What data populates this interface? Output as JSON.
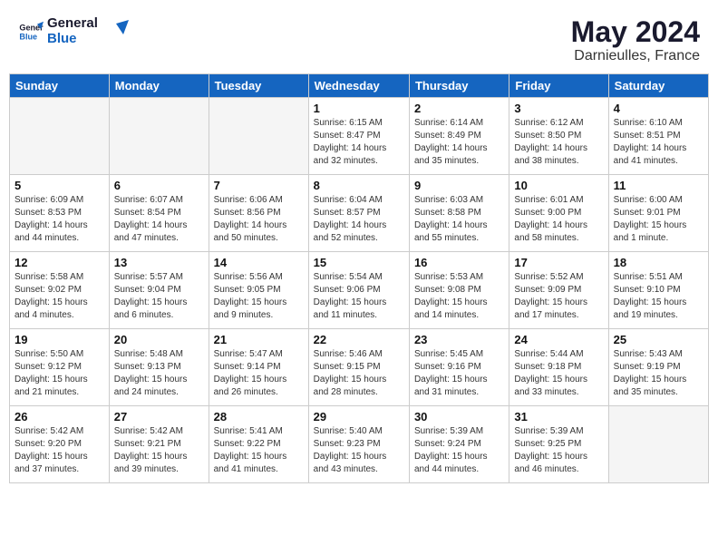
{
  "header": {
    "logo_line1": "General",
    "logo_line2": "Blue",
    "month_year": "May 2024",
    "location": "Darnieulles, France"
  },
  "weekdays": [
    "Sunday",
    "Monday",
    "Tuesday",
    "Wednesday",
    "Thursday",
    "Friday",
    "Saturday"
  ],
  "weeks": [
    [
      {
        "day": "",
        "text": ""
      },
      {
        "day": "",
        "text": ""
      },
      {
        "day": "",
        "text": ""
      },
      {
        "day": "1",
        "text": "Sunrise: 6:15 AM\nSunset: 8:47 PM\nDaylight: 14 hours\nand 32 minutes."
      },
      {
        "day": "2",
        "text": "Sunrise: 6:14 AM\nSunset: 8:49 PM\nDaylight: 14 hours\nand 35 minutes."
      },
      {
        "day": "3",
        "text": "Sunrise: 6:12 AM\nSunset: 8:50 PM\nDaylight: 14 hours\nand 38 minutes."
      },
      {
        "day": "4",
        "text": "Sunrise: 6:10 AM\nSunset: 8:51 PM\nDaylight: 14 hours\nand 41 minutes."
      }
    ],
    [
      {
        "day": "5",
        "text": "Sunrise: 6:09 AM\nSunset: 8:53 PM\nDaylight: 14 hours\nand 44 minutes."
      },
      {
        "day": "6",
        "text": "Sunrise: 6:07 AM\nSunset: 8:54 PM\nDaylight: 14 hours\nand 47 minutes."
      },
      {
        "day": "7",
        "text": "Sunrise: 6:06 AM\nSunset: 8:56 PM\nDaylight: 14 hours\nand 50 minutes."
      },
      {
        "day": "8",
        "text": "Sunrise: 6:04 AM\nSunset: 8:57 PM\nDaylight: 14 hours\nand 52 minutes."
      },
      {
        "day": "9",
        "text": "Sunrise: 6:03 AM\nSunset: 8:58 PM\nDaylight: 14 hours\nand 55 minutes."
      },
      {
        "day": "10",
        "text": "Sunrise: 6:01 AM\nSunset: 9:00 PM\nDaylight: 14 hours\nand 58 minutes."
      },
      {
        "day": "11",
        "text": "Sunrise: 6:00 AM\nSunset: 9:01 PM\nDaylight: 15 hours\nand 1 minute."
      }
    ],
    [
      {
        "day": "12",
        "text": "Sunrise: 5:58 AM\nSunset: 9:02 PM\nDaylight: 15 hours\nand 4 minutes."
      },
      {
        "day": "13",
        "text": "Sunrise: 5:57 AM\nSunset: 9:04 PM\nDaylight: 15 hours\nand 6 minutes."
      },
      {
        "day": "14",
        "text": "Sunrise: 5:56 AM\nSunset: 9:05 PM\nDaylight: 15 hours\nand 9 minutes."
      },
      {
        "day": "15",
        "text": "Sunrise: 5:54 AM\nSunset: 9:06 PM\nDaylight: 15 hours\nand 11 minutes."
      },
      {
        "day": "16",
        "text": "Sunrise: 5:53 AM\nSunset: 9:08 PM\nDaylight: 15 hours\nand 14 minutes."
      },
      {
        "day": "17",
        "text": "Sunrise: 5:52 AM\nSunset: 9:09 PM\nDaylight: 15 hours\nand 17 minutes."
      },
      {
        "day": "18",
        "text": "Sunrise: 5:51 AM\nSunset: 9:10 PM\nDaylight: 15 hours\nand 19 minutes."
      }
    ],
    [
      {
        "day": "19",
        "text": "Sunrise: 5:50 AM\nSunset: 9:12 PM\nDaylight: 15 hours\nand 21 minutes."
      },
      {
        "day": "20",
        "text": "Sunrise: 5:48 AM\nSunset: 9:13 PM\nDaylight: 15 hours\nand 24 minutes."
      },
      {
        "day": "21",
        "text": "Sunrise: 5:47 AM\nSunset: 9:14 PM\nDaylight: 15 hours\nand 26 minutes."
      },
      {
        "day": "22",
        "text": "Sunrise: 5:46 AM\nSunset: 9:15 PM\nDaylight: 15 hours\nand 28 minutes."
      },
      {
        "day": "23",
        "text": "Sunrise: 5:45 AM\nSunset: 9:16 PM\nDaylight: 15 hours\nand 31 minutes."
      },
      {
        "day": "24",
        "text": "Sunrise: 5:44 AM\nSunset: 9:18 PM\nDaylight: 15 hours\nand 33 minutes."
      },
      {
        "day": "25",
        "text": "Sunrise: 5:43 AM\nSunset: 9:19 PM\nDaylight: 15 hours\nand 35 minutes."
      }
    ],
    [
      {
        "day": "26",
        "text": "Sunrise: 5:42 AM\nSunset: 9:20 PM\nDaylight: 15 hours\nand 37 minutes."
      },
      {
        "day": "27",
        "text": "Sunrise: 5:42 AM\nSunset: 9:21 PM\nDaylight: 15 hours\nand 39 minutes."
      },
      {
        "day": "28",
        "text": "Sunrise: 5:41 AM\nSunset: 9:22 PM\nDaylight: 15 hours\nand 41 minutes."
      },
      {
        "day": "29",
        "text": "Sunrise: 5:40 AM\nSunset: 9:23 PM\nDaylight: 15 hours\nand 43 minutes."
      },
      {
        "day": "30",
        "text": "Sunrise: 5:39 AM\nSunset: 9:24 PM\nDaylight: 15 hours\nand 44 minutes."
      },
      {
        "day": "31",
        "text": "Sunrise: 5:39 AM\nSunset: 9:25 PM\nDaylight: 15 hours\nand 46 minutes."
      },
      {
        "day": "",
        "text": ""
      }
    ]
  ]
}
